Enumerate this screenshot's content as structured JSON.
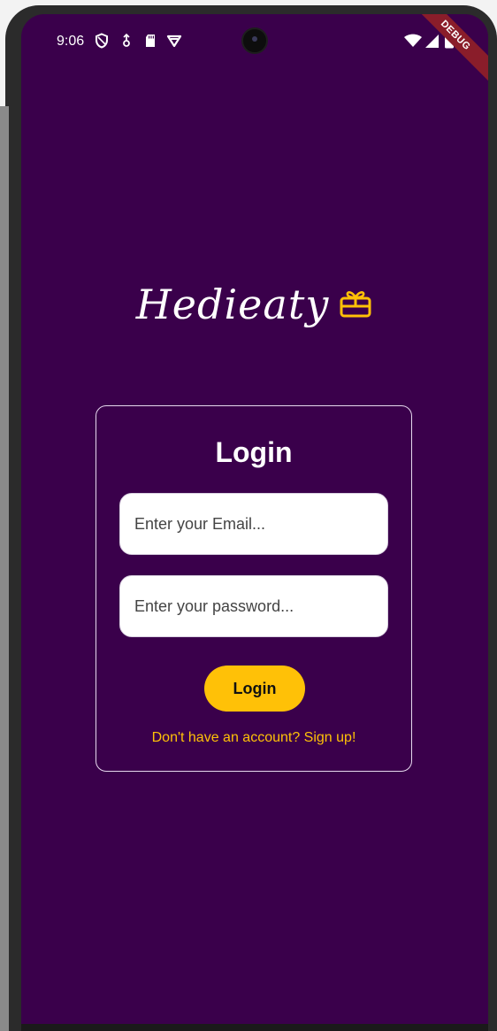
{
  "status_bar": {
    "time": "9:06",
    "icons": [
      "shield-icon",
      "usb-icon",
      "sd-card-icon",
      "vpn-icon",
      "wifi-icon",
      "signal-icon",
      "battery-icon"
    ]
  },
  "debug_banner": "DEBUG",
  "logo": {
    "text": "Hedieaty",
    "icon": "gift-icon"
  },
  "login_card": {
    "title": "Login",
    "email_placeholder": "Enter your Email...",
    "password_placeholder": "Enter your password...",
    "login_button": "Login",
    "signup_link": "Don't have an account? Sign up!"
  },
  "colors": {
    "background": "#3a004b",
    "accent": "#ffc107",
    "field_background": "#ffffff",
    "text_primary": "#ffffff"
  }
}
